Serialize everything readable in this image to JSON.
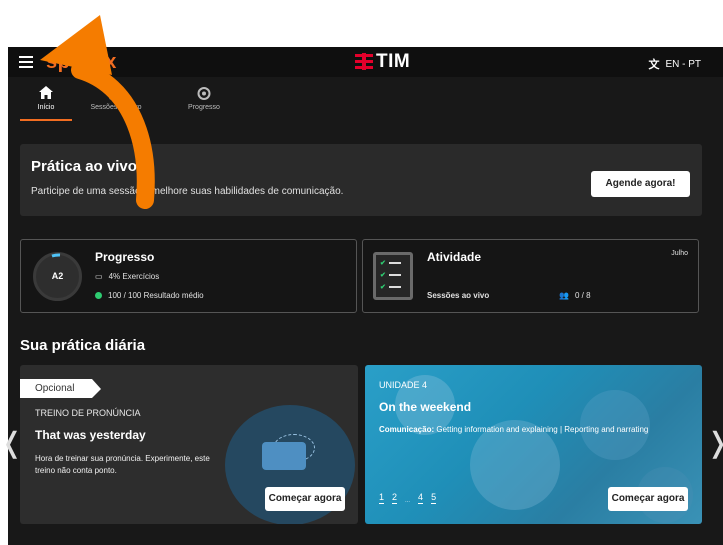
{
  "header": {
    "brand": "speexx",
    "logo_text": "TIM",
    "language": "EN - PT",
    "language_icon": "translate-icon",
    "colors": {
      "brand_orange": "#f26d21",
      "tim_red": "#e4002b"
    }
  },
  "nav": {
    "tabs": [
      {
        "label": "Início",
        "icon": "home-icon",
        "active": true
      },
      {
        "label": "Sessões ao vivo",
        "icon": "calendar-icon",
        "active": false
      },
      {
        "label": "Progresso",
        "icon": "progress-icon",
        "active": false
      }
    ]
  },
  "banner": {
    "title": "Prática ao vivo",
    "description": "Participe de uma sessão e melhore suas habilidades de comunicação.",
    "button": "Agende agora!"
  },
  "progress_card": {
    "level": "A2",
    "title": "Progresso",
    "exercises": "4% Exercícios",
    "result": "100 / 100 Resultado médio"
  },
  "activity_card": {
    "title": "Atividade",
    "month": "Julho",
    "sessions_label": "Sessões ao vivo",
    "sessions_value": "0 / 8"
  },
  "daily": {
    "section_title": "Sua prática diária",
    "left": {
      "tag": "Opcional",
      "subtitle": "TREINO DE PRONÚNCIA",
      "title": "That was yesterday",
      "description": "Hora de treinar sua pronúncia. Experimente, este treino não conta ponto.",
      "button": "Começar agora"
    },
    "right": {
      "unit": "UNIDADE 4",
      "title": "On the weekend",
      "comm_label": "Comunicação:",
      "comm_text": " Getting information and explaining | Reporting and narrating",
      "steps": [
        "1",
        "2",
        "...",
        "4",
        "5"
      ],
      "button": "Começar agora"
    },
    "prev_arrow": "❬",
    "next_arrow": "❭"
  }
}
